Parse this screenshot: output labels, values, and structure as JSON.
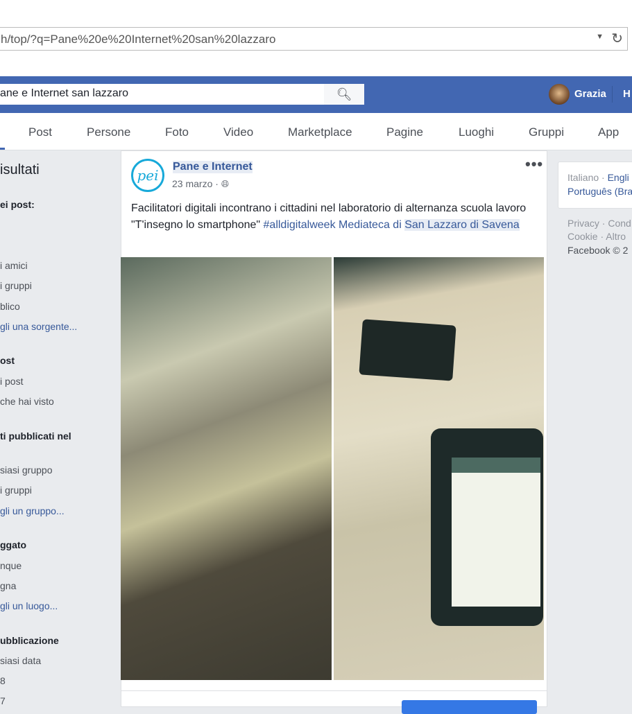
{
  "browser": {
    "url": "h/top/?q=Pane%20e%20Internet%20san%20lazzaro"
  },
  "header": {
    "search_value": "ane e Internet san lazzaro",
    "user": "Grazia",
    "home": "H"
  },
  "tabs": [
    "Post",
    "Persone",
    "Foto",
    "Video",
    "Marketplace",
    "Pagine",
    "Luoghi",
    "Gruppi",
    "App"
  ],
  "sidebar": {
    "title": "isultati",
    "items": [
      {
        "t": "ei post:",
        "k": "b"
      },
      {
        "t": "i amici",
        "k": ""
      },
      {
        "t": "i gruppi",
        "k": ""
      },
      {
        "t": "blico",
        "k": ""
      },
      {
        "t": "gli una sorgente...",
        "k": "l"
      },
      {
        "t": "ost",
        "k": "b"
      },
      {
        "t": "i post",
        "k": ""
      },
      {
        "t": "che hai visto",
        "k": ""
      },
      {
        "t": "ti pubblicati nel",
        "k": "b"
      },
      {
        "t": "siasi gruppo",
        "k": ""
      },
      {
        "t": "i gruppi",
        "k": ""
      },
      {
        "t": "gli un gruppo...",
        "k": "l"
      },
      {
        "t": "ggato",
        "k": "b"
      },
      {
        "t": "nque",
        "k": ""
      },
      {
        "t": "gna",
        "k": ""
      },
      {
        "t": "gli un luogo...",
        "k": "l"
      },
      {
        "t": "ubblicazione",
        "k": "b"
      },
      {
        "t": "siasi data",
        "k": ""
      },
      {
        "t": "8",
        "k": ""
      },
      {
        "t": "7",
        "k": ""
      }
    ]
  },
  "post": {
    "page_name": "Pane e Internet",
    "logo_text": "pei",
    "date": "23 marzo · ",
    "text_1": "Facilitatori digitali incontrano i cittadini nel laboratorio di alternanza scuola lavoro \"T'insegno lo smartphone\" ",
    "hashtag": "#alldigitalweek",
    "text_2": " Mediateca di ",
    "place": "San Lazzaro di Savena",
    "more": "•••"
  },
  "right": {
    "lang_current": "Italiano · ",
    "lang_1": "Engli",
    "lang_2": "Português (Bra",
    "footer_1": "Privacy · Cond",
    "footer_2": "Cookie · Altro",
    "footer_3": "Facebook © 2"
  },
  "colors": {
    "brand": "#4267b2",
    "link": "#365899",
    "background": "#e9ebee"
  }
}
